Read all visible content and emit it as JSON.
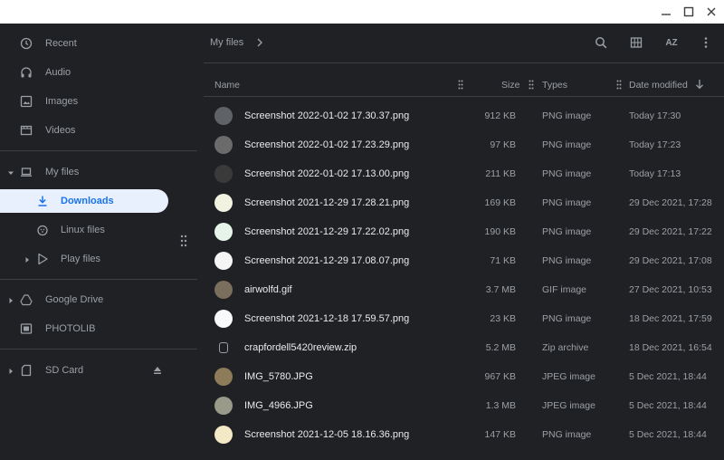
{
  "window": {
    "controls": [
      "minimize-icon",
      "maximize-icon",
      "close-icon"
    ]
  },
  "sidebar": {
    "recent": "Recent",
    "audio": "Audio",
    "images": "Images",
    "videos": "Videos",
    "my_files": "My files",
    "downloads": "Downloads",
    "linux_files": "Linux files",
    "play_files": "Play files",
    "google_drive": "Google Drive",
    "photolib": "PHOTOLIB",
    "sd_card": "SD Card"
  },
  "toolbar": {
    "breadcrumb": "My files",
    "sort_label": "AZ"
  },
  "columns": {
    "name": "Name",
    "size": "Size",
    "types": "Types",
    "date_modified": "Date modified"
  },
  "files": [
    {
      "name": "Screenshot 2022-01-02 17.30.37.png",
      "size": "912 KB",
      "type": "PNG image",
      "date": "Today 17:30",
      "thumb": "#5f6368"
    },
    {
      "name": "Screenshot 2022-01-02 17.23.29.png",
      "size": "97 KB",
      "type": "PNG image",
      "date": "Today 17:23",
      "thumb": "#6b6b6b"
    },
    {
      "name": "Screenshot 2022-01-02 17.13.00.png",
      "size": "211 KB",
      "type": "PNG image",
      "date": "Today 17:13",
      "thumb": "#3a3a3a"
    },
    {
      "name": "Screenshot 2021-12-29 17.28.21.png",
      "size": "169 KB",
      "type": "PNG image",
      "date": "29 Dec 2021, 17:28",
      "thumb": "#f1f3e0"
    },
    {
      "name": "Screenshot 2021-12-29 17.22.02.png",
      "size": "190 KB",
      "type": "PNG image",
      "date": "29 Dec 2021, 17:22",
      "thumb": "#e6f4ea"
    },
    {
      "name": "Screenshot 2021-12-29 17.08.07.png",
      "size": "71 KB",
      "type": "PNG image",
      "date": "29 Dec 2021, 17:08",
      "thumb": "#f5f5f5"
    },
    {
      "name": "airwolfd.gif",
      "size": "3.7 MB",
      "type": "GIF image",
      "date": "27 Dec 2021, 10:53",
      "thumb": "#7a6e5c"
    },
    {
      "name": "Screenshot 2021-12-18 17.59.57.png",
      "size": "23 KB",
      "type": "PNG image",
      "date": "18 Dec 2021, 17:59",
      "thumb": "#f8f9fa"
    },
    {
      "name": "crapfordell5420review.zip",
      "size": "5.2 MB",
      "type": "Zip archive",
      "date": "18 Dec 2021, 16:54",
      "thumb": "zip"
    },
    {
      "name": "IMG_5780.JPG",
      "size": "967 KB",
      "type": "JPEG image",
      "date": "5 Dec 2021, 18:44",
      "thumb": "#8d7b5a"
    },
    {
      "name": "IMG_4966.JPG",
      "size": "1.3 MB",
      "type": "JPEG image",
      "date": "5 Dec 2021, 18:44",
      "thumb": "#9a9a8a"
    },
    {
      "name": "Screenshot 2021-12-05 18.16.36.png",
      "size": "147 KB",
      "type": "PNG image",
      "date": "5 Dec 2021, 18:44",
      "thumb": "#f3e9c6"
    }
  ]
}
